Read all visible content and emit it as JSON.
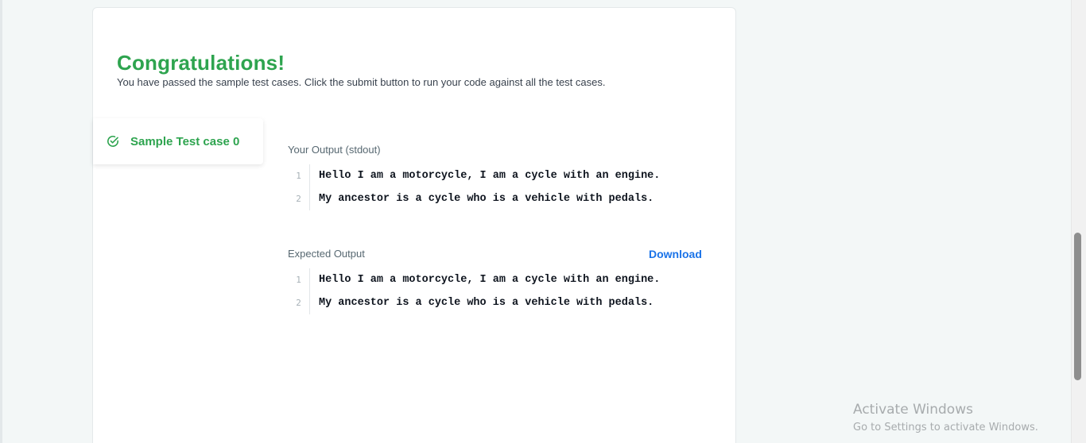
{
  "result": {
    "title": "Congratulations!",
    "subtitle": "You have passed the sample test cases. Click the submit button to run your code against all the test cases."
  },
  "test_cases": [
    {
      "label": "Sample Test case 0",
      "icon": "check-circle-icon",
      "status": "passed"
    }
  ],
  "your_output": {
    "label": "Your Output (stdout)",
    "lines": [
      {
        "no": "1",
        "text": "Hello I am a motorcycle, I am a cycle with an engine."
      },
      {
        "no": "2",
        "text": "My ancestor is a cycle who is a vehicle with pedals."
      }
    ]
  },
  "expected_output": {
    "label": "Expected Output",
    "download_label": "Download",
    "lines": [
      {
        "no": "1",
        "text": "Hello I am a motorcycle, I am a cycle with an engine."
      },
      {
        "no": "2",
        "text": "My ancestor is a cycle who is a vehicle with pedals."
      }
    ]
  },
  "watermark": {
    "title": "Activate Windows",
    "subtitle": "Go to Settings to activate Windows."
  },
  "colors": {
    "success": "#2ea44f",
    "link": "#1a73e8",
    "text": "#39424e",
    "muted": "#576871"
  }
}
